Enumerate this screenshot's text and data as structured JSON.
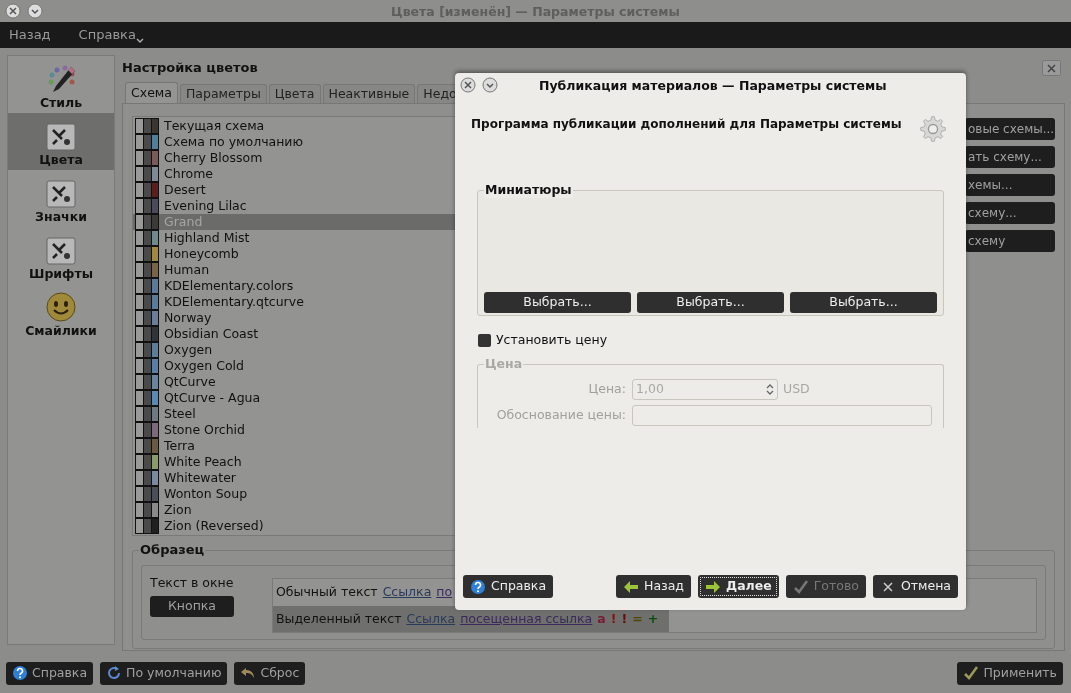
{
  "window": {
    "title": "Цвета [изменён] — Параметры системы"
  },
  "menu": [
    {
      "label": "Назад",
      "dropdown": false
    },
    {
      "label": "Справка",
      "dropdown": true
    }
  ],
  "sidebar": {
    "items": [
      {
        "label": "Стиль",
        "kind": "palette",
        "selected": false
      },
      {
        "label": "Цвета",
        "kind": "tools",
        "selected": true
      },
      {
        "label": "Значки",
        "kind": "tools",
        "selected": false
      },
      {
        "label": "Шрифты",
        "kind": "tools",
        "selected": false
      },
      {
        "label": "Смайлики",
        "kind": "smiley",
        "selected": false
      }
    ]
  },
  "page_title": "Настройка цветов",
  "tabs": [
    {
      "label": "Схема",
      "selected": true
    },
    {
      "label": "Параметры",
      "selected": false
    },
    {
      "label": "Цвета",
      "selected": false
    },
    {
      "label": "Неактивные",
      "selected": false
    },
    {
      "label": "Недо",
      "selected": false
    }
  ],
  "schemes": [
    {
      "name": "Текущая схема",
      "color": "#3a3530",
      "selected": false
    },
    {
      "name": "Схема по умолчанию",
      "color": "#4f7f9a",
      "selected": false
    },
    {
      "name": "Cherry Blossom",
      "color": "#7a5a5a",
      "selected": false
    },
    {
      "name": "Chrome",
      "color": "#7f8a94",
      "selected": false
    },
    {
      "name": "Desert",
      "color": "#5a1e1e",
      "selected": false
    },
    {
      "name": "Evening Lilac",
      "color": "#4a4a5a",
      "selected": false
    },
    {
      "name": "Grand",
      "color": "#3c3a36",
      "selected": true
    },
    {
      "name": "Highland Mist",
      "color": "#6f8a8a",
      "selected": false
    },
    {
      "name": "Honeycomb",
      "color": "#a08840",
      "selected": false
    },
    {
      "name": "Human",
      "color": "#7a6448",
      "selected": false
    },
    {
      "name": "KDElementary.colors",
      "color": "#5a7a9a",
      "selected": false
    },
    {
      "name": "KDElementary.qtcurve",
      "color": "#5a7a9a",
      "selected": false
    },
    {
      "name": "Norway",
      "color": "#6a7e9a",
      "selected": false
    },
    {
      "name": "Obsidian Coast",
      "color": "#303438",
      "selected": false
    },
    {
      "name": "Oxygen",
      "color": "#5a7d9a",
      "selected": false
    },
    {
      "name": "Oxygen Cold",
      "color": "#5a7fa4",
      "selected": false
    },
    {
      "name": "QtCurve",
      "color": "#6a84a0",
      "selected": false
    },
    {
      "name": "QtCurve - Agua",
      "color": "#5a8ab4",
      "selected": false
    },
    {
      "name": "Steel",
      "color": "#707880",
      "selected": false
    },
    {
      "name": "Stone Orchid",
      "color": "#7a6a7a",
      "selected": false
    },
    {
      "name": "Terra",
      "color": "#6a5a40",
      "selected": false
    },
    {
      "name": "White Peach",
      "color": "#8a9a6a",
      "selected": false
    },
    {
      "name": "Whitewater",
      "color": "#7a8aa0",
      "selected": false
    },
    {
      "name": "Wonton Soup",
      "color": "#4a4e56",
      "selected": false
    },
    {
      "name": "Zion",
      "color": "#8a8a8a",
      "selected": false
    },
    {
      "name": "Zion (Reversed)",
      "color": "#202020",
      "selected": false
    }
  ],
  "scheme_buttons": [
    "овые схемы...",
    "ать схему...",
    "хемы...",
    "схему...",
    "схему"
  ],
  "preview": {
    "title": "Образец",
    "window_text": "Текст в окне",
    "button": "Кнопка",
    "normal": {
      "text": "Обычный текст",
      "link": "Ссылка",
      "visited": "по"
    },
    "selected": {
      "text": "Выделенный текст",
      "link": "Ссылка",
      "visited": "посещенная ссылка",
      "marks": [
        {
          "text": "a",
          "color": "#7a1a3a"
        },
        {
          "text": "!",
          "color": "#8a1010"
        },
        {
          "text": "!",
          "color": "#6a0a0a"
        },
        {
          "text": "=",
          "color": "#4a4a00"
        },
        {
          "text": "+",
          "color": "#0a4a0a"
        }
      ]
    }
  },
  "footer": {
    "left": [
      {
        "label": "Справка",
        "kind": "help"
      },
      {
        "label": "По умолчанию",
        "kind": "default"
      },
      {
        "label": "Сброс",
        "kind": "reset"
      }
    ],
    "right": [
      {
        "label": "Применить",
        "kind": "apply"
      }
    ]
  },
  "dialog": {
    "title": "Публикация материалов — Параметры системы",
    "heading": "Программа публикации дополнений для Параметры системы",
    "thumbnails": {
      "title": "Миниатюры",
      "buttons": [
        "Выбрать...",
        "Выбрать...",
        "Выбрать..."
      ]
    },
    "set_price": {
      "label": "Установить цену",
      "checked": false
    },
    "price": {
      "title": "Цена",
      "disabled": true,
      "fields": [
        {
          "label": "Цена:",
          "kind": "spin",
          "value": "1,00",
          "suffix": "USD"
        },
        {
          "label": "Обоснование цены:",
          "kind": "text"
        }
      ]
    },
    "buttons": [
      {
        "label": "Справка",
        "kind": "help",
        "disabled": false,
        "default": false
      },
      {
        "label": "Назад",
        "kind": "back",
        "disabled": false,
        "default": false
      },
      {
        "label": "Далее",
        "kind": "next",
        "disabled": false,
        "default": true
      },
      {
        "label": "Готово",
        "kind": "finish",
        "disabled": true,
        "default": false
      },
      {
        "label": "Отмена",
        "kind": "cancel",
        "disabled": false,
        "default": false
      }
    ]
  }
}
